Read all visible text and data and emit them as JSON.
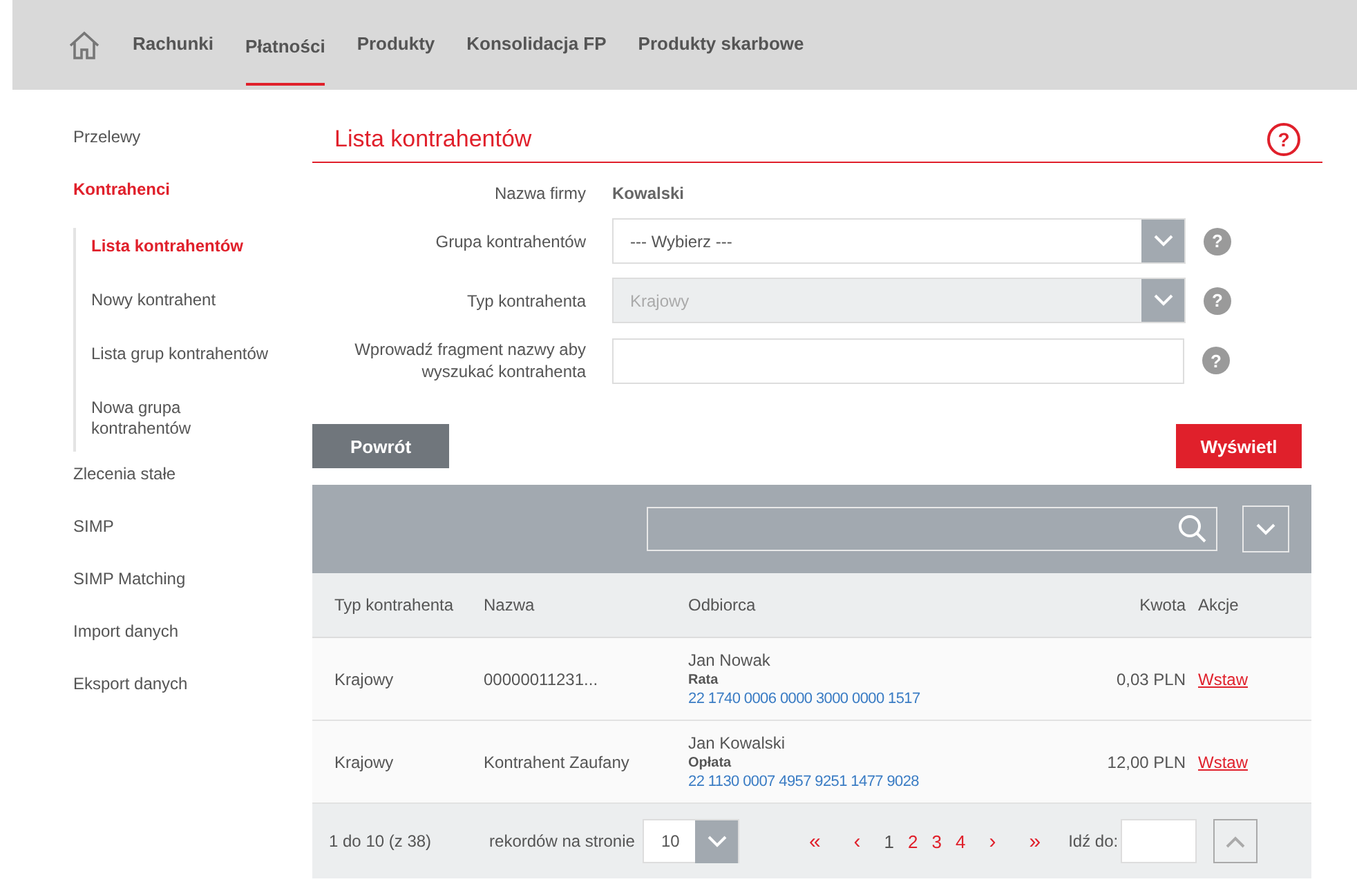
{
  "nav": {
    "items": [
      {
        "label": "Rachunki",
        "selected": false
      },
      {
        "label": "Płatności",
        "selected": true
      },
      {
        "label": "Produkty",
        "selected": false
      },
      {
        "label": "Konsolidacja FP",
        "selected": false
      },
      {
        "label": "Produkty skarbowe",
        "selected": false
      }
    ]
  },
  "sidebar": {
    "items": [
      {
        "label": "Przelewy",
        "selected": false
      },
      {
        "label": "Kontrahenci",
        "selected": true,
        "expanded": true,
        "children": [
          {
            "label": "Lista kontrahentów",
            "selected": true
          },
          {
            "label": "Nowy kontrahent",
            "selected": false
          },
          {
            "label": "Lista grup kontrahentów",
            "selected": false
          },
          {
            "label": "Nowa grupa kontrahentów",
            "selected": false
          }
        ]
      },
      {
        "label": "Zlecenia stałe",
        "selected": false
      },
      {
        "label": "SIMP",
        "selected": false
      },
      {
        "label": "SIMP Matching",
        "selected": false
      },
      {
        "label": "Import danych",
        "selected": false
      },
      {
        "label": "Eksport danych",
        "selected": false
      }
    ]
  },
  "page": {
    "title": "Lista kontrahentów",
    "help": "?"
  },
  "form": {
    "fields": [
      {
        "kind": "static",
        "label": "Nazwa firmy",
        "value": "Kowalski"
      },
      {
        "kind": "select",
        "label": "Grupa kontrahentów",
        "value": "--- Wybierz ---",
        "disabled": false,
        "help": "?"
      },
      {
        "kind": "select",
        "label": "Typ kontrahenta",
        "value": "Krajowy",
        "disabled": true,
        "help": "?"
      },
      {
        "kind": "text",
        "label": "Wprowadź fragment nazwy aby wyszukać kontrahenta",
        "help": "?"
      }
    ],
    "buttons": {
      "back": "Powrót",
      "show": "Wyświetl"
    }
  },
  "table": {
    "columns": [
      "Typ kontrahenta",
      "Nazwa",
      "Odbiorca",
      "Kwota",
      "Akcje"
    ],
    "rows": [
      {
        "type": "Krajowy",
        "name": "00000011231...",
        "recipient": "Jan Nowak",
        "title": "Rata",
        "account": "22 1740 0006 0000 3000 0000 1517",
        "amount": "0,03 PLN",
        "action": "Wstaw"
      },
      {
        "type": "Krajowy",
        "name": "Kontrahent Zaufany",
        "recipient": "Jan Kowalski",
        "title": "Opłata",
        "account": "22 1130 0007 4957 9251 1477 9028",
        "amount": "12,00 PLN",
        "action": "Wstaw"
      }
    ]
  },
  "pagination": {
    "summary": "1 do 10 (z 38)",
    "per_page_label": "rekordów na stronie",
    "per_page": "10",
    "first": "«",
    "prev": "‹",
    "pages": [
      {
        "label": "1",
        "selected": true
      },
      {
        "label": "2",
        "selected": false
      },
      {
        "label": "3",
        "selected": false
      },
      {
        "label": "4",
        "selected": false
      }
    ],
    "next": "›",
    "last": "»",
    "goto_label": "Idź do:"
  }
}
